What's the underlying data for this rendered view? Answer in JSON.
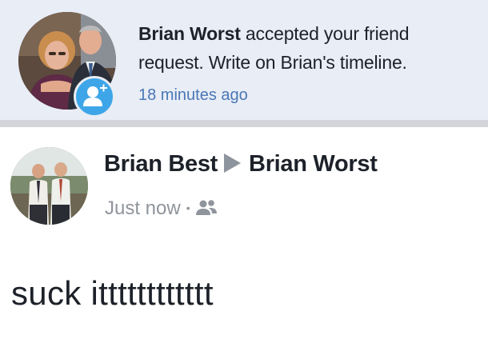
{
  "notification": {
    "actor": "Brian Worst",
    "message": " accepted your friend request. Write on Brian's timeline.",
    "time": "18 minutes ago",
    "badge_icon": "add-friend-icon"
  },
  "post": {
    "author": "Brian Best",
    "target": "Brian Worst",
    "time": "Just now",
    "separator": "•",
    "audience_icon": "friends-icon",
    "body": "suck itttttttttttt"
  },
  "colors": {
    "notification_bg": "#e8edf6",
    "badge": "#3ea6e8",
    "timestamp_link": "#4a77b5",
    "meta_gray": "#90949c"
  }
}
